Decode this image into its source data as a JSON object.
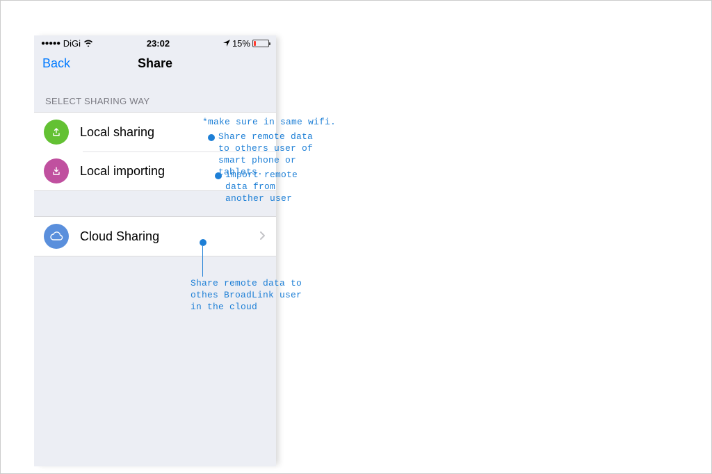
{
  "status": {
    "carrier": "DiGi",
    "time": "23:02",
    "battery": "15%"
  },
  "nav": {
    "back": "Back",
    "title": "Share"
  },
  "section": {
    "header": "SELECT SHARING WAY"
  },
  "rows": {
    "local_sharing": "Local sharing",
    "local_importing": "Local importing",
    "cloud_sharing": "Cloud Sharing"
  },
  "annotations": {
    "wifi_note": "*make sure in same wifi.",
    "local_sharing_note": "Share remote data to others user of smart phone or tablets.",
    "local_importing_note": "import remote data from another user",
    "cloud_note": "Share remote data to othes BroadLink user in the cloud"
  }
}
